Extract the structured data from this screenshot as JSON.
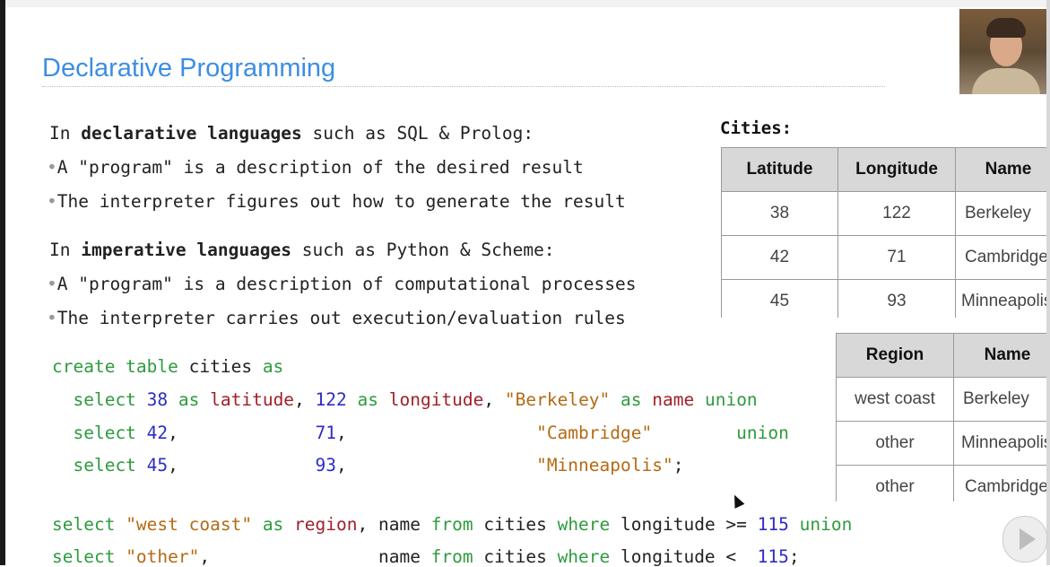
{
  "slide": {
    "title": "Declarative Programming"
  },
  "text": {
    "p1_pre": "In ",
    "p1_bold": "declarative languages",
    "p1_post": " such as SQL & Prolog:",
    "b1": "A \"program\" is a description of the desired result",
    "b2": "The interpreter figures out how to generate the result",
    "p2_pre": "In ",
    "p2_bold": "imperative languages",
    "p2_post": " such as Python & Scheme:",
    "b3": "A \"program\" is a description of computational processes",
    "b4": "The interpreter carries out execution/evaluation rules",
    "bullet": "•"
  },
  "code": {
    "l1": [
      {
        "t": "create table ",
        "c": "kw"
      },
      {
        "t": "cities ",
        "c": "plain"
      },
      {
        "t": "as",
        "c": "kw"
      }
    ],
    "l2": [
      {
        "t": "  select ",
        "c": "kw"
      },
      {
        "t": "38",
        "c": "num"
      },
      {
        "t": " as ",
        "c": "kw"
      },
      {
        "t": "latitude",
        "c": "id"
      },
      {
        "t": ", ",
        "c": "plain"
      },
      {
        "t": "122",
        "c": "num"
      },
      {
        "t": " as ",
        "c": "kw"
      },
      {
        "t": "longitude",
        "c": "id"
      },
      {
        "t": ", ",
        "c": "plain"
      },
      {
        "t": "\"Berkeley\"",
        "c": "str"
      },
      {
        "t": " as ",
        "c": "kw"
      },
      {
        "t": "name",
        "c": "id"
      },
      {
        "t": " union",
        "c": "kw"
      }
    ],
    "l3": [
      {
        "t": "  select ",
        "c": "kw"
      },
      {
        "t": "42",
        "c": "num"
      },
      {
        "t": ",             ",
        "c": "plain"
      },
      {
        "t": "71",
        "c": "num"
      },
      {
        "t": ",                  ",
        "c": "plain"
      },
      {
        "t": "\"Cambridge\"",
        "c": "str"
      },
      {
        "t": "        union",
        "c": "kw"
      }
    ],
    "l4": [
      {
        "t": "  select ",
        "c": "kw"
      },
      {
        "t": "45",
        "c": "num"
      },
      {
        "t": ",             ",
        "c": "plain"
      },
      {
        "t": "93",
        "c": "num"
      },
      {
        "t": ",                  ",
        "c": "plain"
      },
      {
        "t": "\"Minneapolis\"",
        "c": "str"
      },
      {
        "t": ";",
        "c": "plain"
      }
    ],
    "l5": [
      {
        "t": "select ",
        "c": "kw"
      },
      {
        "t": "\"west coast\"",
        "c": "str"
      },
      {
        "t": " as ",
        "c": "kw"
      },
      {
        "t": "region",
        "c": "id"
      },
      {
        "t": ", name ",
        "c": "plain"
      },
      {
        "t": "from ",
        "c": "kw"
      },
      {
        "t": "cities ",
        "c": "plain"
      },
      {
        "t": "where ",
        "c": "kw"
      },
      {
        "t": "longitude >= ",
        "c": "plain"
      },
      {
        "t": "115",
        "c": "num"
      },
      {
        "t": " union",
        "c": "kw"
      }
    ],
    "l6": [
      {
        "t": "select ",
        "c": "kw"
      },
      {
        "t": "\"other\"",
        "c": "str"
      },
      {
        "t": ",                ",
        "c": "plain"
      },
      {
        "t": "name ",
        "c": "plain"
      },
      {
        "t": "from ",
        "c": "kw"
      },
      {
        "t": "cities ",
        "c": "plain"
      },
      {
        "t": "where ",
        "c": "kw"
      },
      {
        "t": "longitude <  ",
        "c": "plain"
      },
      {
        "t": "115",
        "c": "num"
      },
      {
        "t": ";",
        "c": "plain"
      }
    ]
  },
  "cities": {
    "label": "Cities:",
    "headers": [
      "Latitude",
      "Longitude",
      "Name"
    ],
    "rows": [
      [
        "38",
        "122",
        "Berkeley"
      ],
      [
        "42",
        "71",
        "Cambridge"
      ],
      [
        "45",
        "93",
        "Minneapolis"
      ]
    ]
  },
  "regions": {
    "headers": [
      "Region",
      "Name"
    ],
    "rows": [
      [
        "west coast",
        "Berkeley"
      ],
      [
        "other",
        "Minneapolis"
      ],
      [
        "other",
        "Cambridge"
      ]
    ]
  },
  "colors": {
    "title": "#3d8ee3",
    "keyword": "#2e9b3e",
    "number": "#2c2cc4",
    "string": "#b56a14",
    "identifier": "#a0202a",
    "table_header_bg": "#d8d8d8"
  },
  "icons": {
    "cursor": "mouse-pointer-icon",
    "play": "play-icon"
  }
}
